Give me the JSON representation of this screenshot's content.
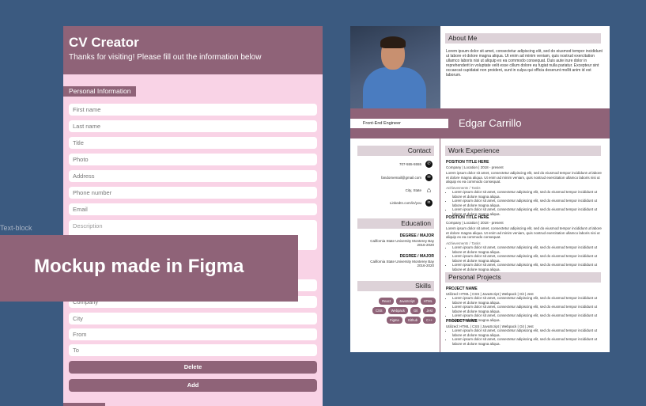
{
  "form": {
    "title": "CV Creator",
    "subtitle": "Thanks for visiting! Please fill out the information below",
    "section_personal": "Personal Information",
    "placeholders": [
      "First name",
      "Last name",
      "Title",
      "Photo",
      "Address",
      "Phone number",
      "Email",
      "Description"
    ],
    "work_placeholders": [
      "Company",
      "City",
      "From",
      "To"
    ],
    "delete_label": "Delete",
    "add_label": "Add"
  },
  "side_label": "Text-block",
  "overlay": {
    "text": "Mockup made in Figma"
  },
  "resume": {
    "about_title": "About Me",
    "about_text": "Lorem ipsum dolor sit amet, consectetur adipiscing elit, sed do eiusmod tempor incididunt ut labore et dolore magna aliqua. Ut enim ad minim veniam, quis nostrud exercitation ullamco laboris nisi ut aliquip ex ea commodo consequat. Duis aute irure dolor in reprehenderit in voluptate velit esse cillum dolore eu fugiat nulla pariatur. Excepteur sint occaecat cupidatat non proident, sunt in culpa qui officia deserunt mollit anim id est laborum.",
    "role": "Front-End Engineer",
    "name": "Edgar Carrillo",
    "contact_title": "Contact",
    "contacts": [
      {
        "text": "707-555-5555",
        "icon": "phone-icon"
      },
      {
        "text": "fandomemail@gmail.com",
        "icon": "email-icon"
      },
      {
        "text": "City, State",
        "icon": "home-icon"
      },
      {
        "text": "LinkedIn.com/in/you",
        "icon": "linkedin-icon"
      }
    ],
    "education_title": "Education",
    "education": [
      {
        "degree": "DEGREE / MAJOR",
        "school": "California State University Monterey Bay",
        "years": "2016-2020"
      },
      {
        "degree": "DEGREE / MAJOR",
        "school": "California State University Monterey Bay",
        "years": "2016-2020"
      }
    ],
    "skills_title": "Skills",
    "skills": [
      "React",
      "JavaScript",
      "HTML",
      "CSS",
      "Webpack",
      "Git",
      "Jest",
      "Figma",
      "Github",
      "C++"
    ],
    "work_title": "Work Experience",
    "jobs": [
      {
        "title": "POSITION TITLE HERE",
        "sub": "Company | Location | 2018 - present",
        "desc": "Lorem ipsum dolor sit amet, consectetur adipiscing elit, sed do eiusmod tempor incididunt ut labore et dolore magna aliqua. Ut enim ad minim veniam, quis nostrud exercitation ullamco laboris nisi ut aliquip ex ea commodo consequat.",
        "tasks_label": "Achievements / Tasks",
        "bullets": [
          "Lorem ipsum dolor sit amet, consectetur adipiscing elit, sed do eiusmod tempor incididunt ut labore et dolore magna aliqua.",
          "Lorem ipsum dolor sit amet, consectetur adipiscing elit, sed do eiusmod tempor incididunt ut labore et dolore magna aliqua.",
          "Lorem ipsum dolor sit amet, consectetur adipiscing elit, sed do eiusmod tempor incididunt ut labore et dolore magna aliqua."
        ]
      },
      {
        "title": "POSITION TITLE HERE",
        "sub": "Company | Location | 2018 - present",
        "desc": "Lorem ipsum dolor sit amet, consectetur adipiscing elit, sed do eiusmod tempor incididunt ut labore et dolore magna aliqua. Ut enim ad minim veniam, quis nostrud exercitation ullamco laboris nisi ut aliquip ex ea commodo consequat.",
        "tasks_label": "Achievements / Tasks",
        "bullets": [
          "Lorem ipsum dolor sit amet, consectetur adipiscing elit, sed do eiusmod tempor incididunt ut labore et dolore magna aliqua.",
          "Lorem ipsum dolor sit amet, consectetur adipiscing elit, sed do eiusmod tempor incididunt ut labore et dolore magna aliqua.",
          "Lorem ipsum dolor sit amet, consectetur adipiscing elit, sed do eiusmod tempor incididunt ut labore et dolore magna aliqua."
        ]
      }
    ],
    "projects_title": "Personal Projects",
    "projects": [
      {
        "name": "PROJECT NAME",
        "stack": "Utilized: HTML | CSS | JavaScript | Webpack | Git | Jest",
        "bullets": [
          "Lorem ipsum dolor sit amet, consectetur adipiscing elit, sed do eiusmod tempor incididunt ut labore et dolore magna aliqua.",
          "Lorem ipsum dolor sit amet, consectetur adipiscing elit, sed do eiusmod tempor incididunt ut labore et dolore magna aliqua.",
          "Lorem ipsum dolor sit amet, consectetur adipiscing elit, sed do eiusmod tempor incididunt ut labore et dolore magna aliqua."
        ]
      },
      {
        "name": "PROJECT NAME",
        "stack": "Utilized: HTML | CSS | JavaScript | Webpack | Git | Jest",
        "bullets": [
          "Lorem ipsum dolor sit amet, consectetur adipiscing elit, sed do eiusmod tempor incididunt ut labore et dolore magna aliqua.",
          "Lorem ipsum dolor sit amet, consectetur adipiscing elit, sed do eiusmod tempor incididunt ut labore et dolore magna aliqua."
        ]
      }
    ]
  }
}
